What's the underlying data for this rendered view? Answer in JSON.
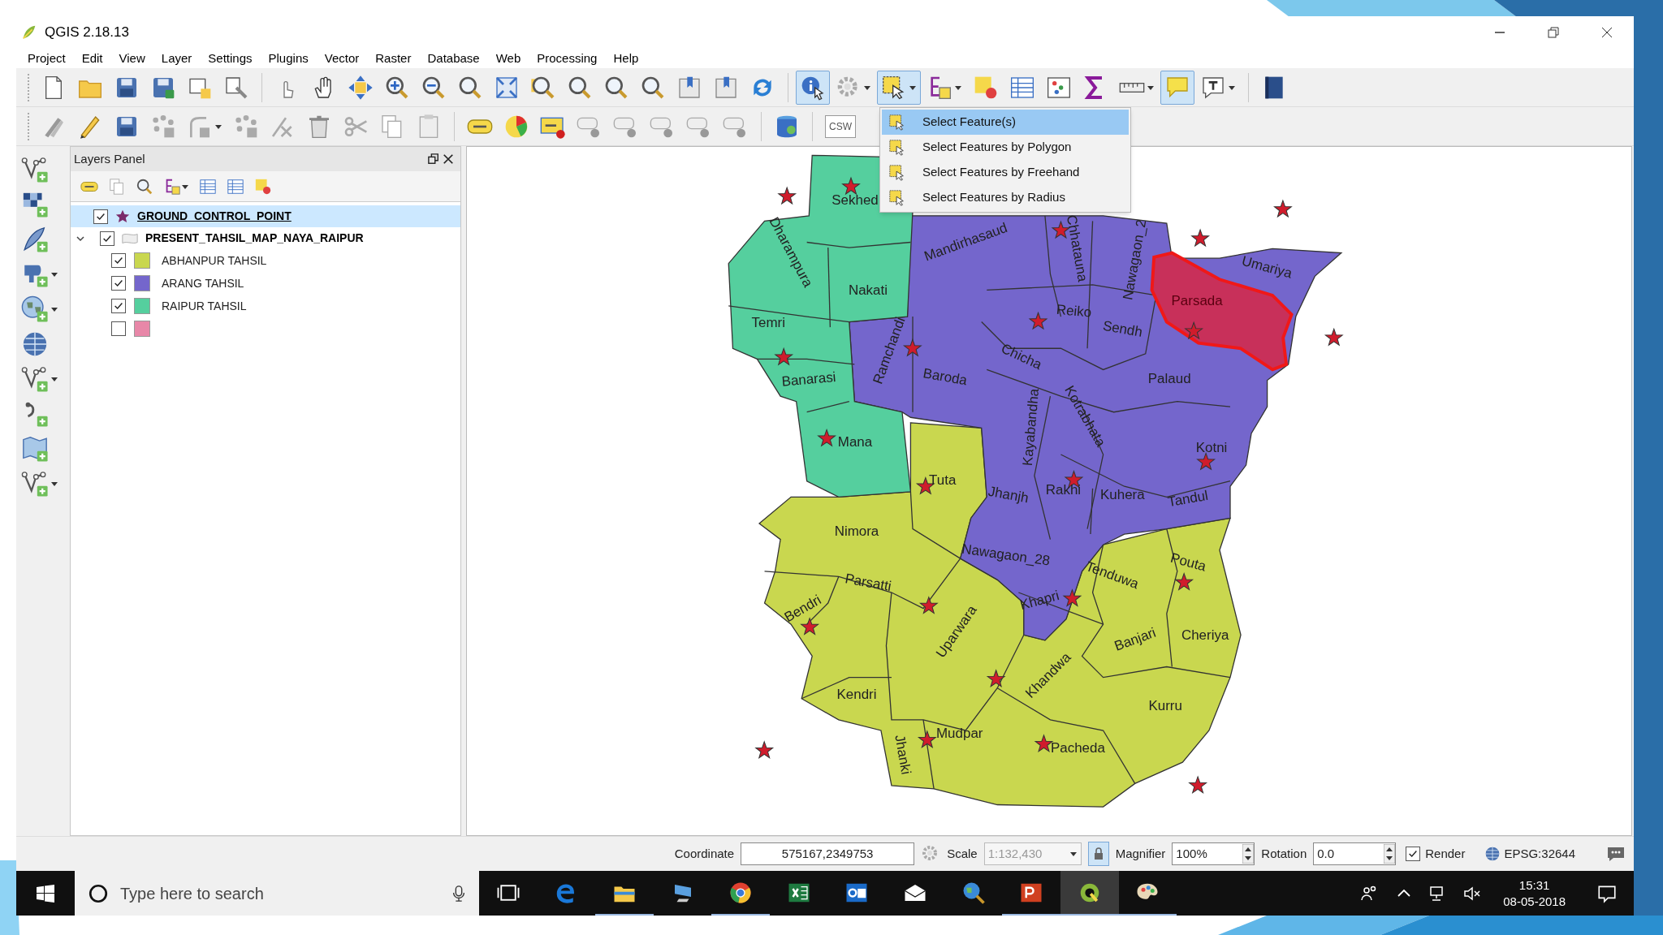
{
  "window": {
    "title": "QGIS 2.18.13"
  },
  "menu": [
    "Project",
    "Edit",
    "View",
    "Layer",
    "Settings",
    "Plugins",
    "Vector",
    "Raster",
    "Database",
    "Web",
    "Processing",
    "Help"
  ],
  "toolbar_1": [
    {
      "kind": "new",
      "pressed": false
    },
    {
      "kind": "open",
      "pressed": false
    },
    {
      "kind": "save",
      "pressed": false
    },
    {
      "kind": "save-as",
      "pressed": false
    },
    {
      "kind": "composer",
      "pressed": false
    },
    {
      "kind": "composer-manager",
      "pressed": false
    },
    {
      "kind": "separator"
    },
    {
      "kind": "touch",
      "pressed": false
    },
    {
      "kind": "pan",
      "pressed": false
    },
    {
      "kind": "pan-selection",
      "pressed": false
    },
    {
      "kind": "zoom-in",
      "pressed": false
    },
    {
      "kind": "zoom-out",
      "pressed": false
    },
    {
      "kind": "zoom-actual",
      "pressed": false
    },
    {
      "kind": "zoom-full",
      "pressed": false
    },
    {
      "kind": "zoom-selection",
      "pressed": false
    },
    {
      "kind": "zoom-layer",
      "pressed": false
    },
    {
      "kind": "zoom-last",
      "pressed": false
    },
    {
      "kind": "zoom-next",
      "pressed": false
    },
    {
      "kind": "bookmark",
      "pressed": false
    },
    {
      "kind": "bookmarks",
      "pressed": false
    },
    {
      "kind": "refresh",
      "pressed": false
    },
    {
      "kind": "separator"
    },
    {
      "kind": "identify",
      "pressed": true
    },
    {
      "kind": "action",
      "pressed": false,
      "menu": true
    },
    {
      "kind": "select",
      "pressed": true,
      "menu": true
    },
    {
      "kind": "select-expression",
      "pressed": false,
      "menu": true
    },
    {
      "kind": "deselect",
      "pressed": false
    },
    {
      "kind": "attribute-table",
      "pressed": false
    },
    {
      "kind": "field-calculator",
      "pressed": false
    },
    {
      "kind": "statistics",
      "pressed": false
    },
    {
      "kind": "measure",
      "pressed": false,
      "menu": true
    },
    {
      "kind": "map-tips",
      "pressed": true
    },
    {
      "kind": "annotation",
      "pressed": false,
      "menu": true
    },
    {
      "kind": "separator"
    },
    {
      "kind": "help",
      "pressed": false
    }
  ],
  "toolbar_2": [
    {
      "kind": "digitize",
      "pressed": false
    },
    {
      "kind": "edit",
      "pressed": false
    },
    {
      "kind": "save-edits",
      "pressed": false
    },
    {
      "kind": "add-feature",
      "pressed": false
    },
    {
      "kind": "add-part",
      "pressed": false,
      "menu": true
    },
    {
      "kind": "move-feature",
      "pressed": false
    },
    {
      "kind": "node-tool",
      "pressed": false
    },
    {
      "kind": "delete",
      "pressed": false
    },
    {
      "kind": "cut",
      "pressed": false
    },
    {
      "kind": "copy",
      "pressed": false
    },
    {
      "kind": "paste",
      "pressed": false
    },
    {
      "kind": "separator"
    },
    {
      "kind": "label",
      "pressed": false
    },
    {
      "kind": "diagram",
      "pressed": false
    },
    {
      "kind": "highlight-label",
      "pressed": false
    },
    {
      "kind": "pin-label",
      "pressed": false
    },
    {
      "kind": "show-label",
      "pressed": false
    },
    {
      "kind": "move-label",
      "pressed": false
    },
    {
      "kind": "rotate-label",
      "pressed": false
    },
    {
      "kind": "change-label",
      "pressed": false
    },
    {
      "kind": "separator"
    },
    {
      "kind": "database",
      "pressed": false
    },
    {
      "kind": "separator"
    },
    {
      "kind": "text",
      "label": "CSW",
      "pressed": false
    }
  ],
  "select_menu": [
    {
      "label": "Select Feature(s)",
      "selected": true
    },
    {
      "label": "Select Features by Polygon",
      "selected": false
    },
    {
      "label": "Select Features by Freehand",
      "selected": false
    },
    {
      "label": "Select Features by Radius",
      "selected": false
    }
  ],
  "layers_panel": {
    "title": "Layers Panel",
    "layers": [
      {
        "name": "GROUND_CONTROL_POINT",
        "kind": "point",
        "checked": true,
        "selected": true
      },
      {
        "name": "PRESENT_TAHSIL_MAP_NAYA_RAIPUR",
        "kind": "polygon",
        "checked": true,
        "selected": false,
        "expanded": true,
        "children": [
          {
            "label": "ABHANPUR TAHSIL",
            "checked": true,
            "color": "#c9d74f"
          },
          {
            "label": "ARANG TAHSIL",
            "checked": true,
            "color": "#7466cc"
          },
          {
            "label": "RAIPUR TAHSIL",
            "checked": true,
            "color": "#55cf9e"
          },
          {
            "checked": false,
            "color": "#e887a8"
          }
        ]
      }
    ]
  },
  "map": {
    "labels": [
      {
        "text": "Sekhed",
        "selected": false
      },
      {
        "text": "Dharampura",
        "selected": false
      },
      {
        "text": "Nakati",
        "selected": false
      },
      {
        "text": "Temri",
        "selected": false
      },
      {
        "text": "Mandirhasaud",
        "selected": false
      },
      {
        "text": "Chhatauna",
        "selected": false
      },
      {
        "text": "Nawagaon_2",
        "selected": false
      },
      {
        "text": "Umariya",
        "selected": false
      },
      {
        "text": "Parsada",
        "selected": true
      },
      {
        "text": "Reiko",
        "selected": false
      },
      {
        "text": "Sendh",
        "selected": false
      },
      {
        "text": "Ramchandi",
        "selected": false
      },
      {
        "text": "Chicha",
        "selected": false
      },
      {
        "text": "Baroda",
        "selected": false
      },
      {
        "text": "Banarasi",
        "selected": false
      },
      {
        "text": "Palaud",
        "selected": false
      },
      {
        "text": "Kayabandha",
        "selected": false
      },
      {
        "text": "Kotrabhata",
        "selected": false
      },
      {
        "text": "Mana",
        "selected": false
      },
      {
        "text": "Kotni",
        "selected": false
      },
      {
        "text": "Tuta",
        "selected": false
      },
      {
        "text": "Jhanjh",
        "selected": false
      },
      {
        "text": "Rakhi",
        "selected": false
      },
      {
        "text": "Kuhera",
        "selected": false
      },
      {
        "text": "Tandul",
        "selected": false
      },
      {
        "text": "Nimora",
        "selected": false
      },
      {
        "text": "Nawagaon_28",
        "selected": false
      },
      {
        "text": "Tenduwa",
        "selected": false
      },
      {
        "text": "Pouta",
        "selected": false
      },
      {
        "text": "Parsatti",
        "selected": false
      },
      {
        "text": "Khapri",
        "selected": false
      },
      {
        "text": "Bendri",
        "selected": false
      },
      {
        "text": "Uparwara",
        "selected": false
      },
      {
        "text": "Banjari",
        "selected": false
      },
      {
        "text": "Cheriya",
        "selected": false
      },
      {
        "text": "Khandwa",
        "selected": false
      },
      {
        "text": "Kendri",
        "selected": false
      },
      {
        "text": "Kurru",
        "selected": false
      },
      {
        "text": "Mudpar",
        "selected": false
      },
      {
        "text": "Jhanki",
        "selected": false
      },
      {
        "text": "Pacheda",
        "selected": false
      }
    ]
  },
  "status_bar": {
    "coordinate_label": "Coordinate",
    "coordinate": "575167,2349753",
    "scale_label": "Scale",
    "scale": "1:132,430",
    "magnifier_label": "Magnifier",
    "magnifier": "100%",
    "rotation_label": "Rotation",
    "rotation": "0.0",
    "render": {
      "label": "Render",
      "checked": true
    },
    "crs": "EPSG:32644"
  },
  "taskbar": {
    "search_placeholder": "Type here to search",
    "time": "15:31",
    "date": "08-05-2018",
    "apps": [
      {
        "kind": "task-view",
        "running": false,
        "selected": false
      },
      {
        "kind": "edge",
        "running": false,
        "selected": false
      },
      {
        "kind": "explorer",
        "running": true,
        "selected": false
      },
      {
        "kind": "monitor",
        "running": false,
        "selected": false
      },
      {
        "kind": "chrome",
        "running": true,
        "selected": false
      },
      {
        "kind": "excel",
        "running": false,
        "selected": false
      },
      {
        "kind": "outlook",
        "running": false,
        "selected": false
      },
      {
        "kind": "mail",
        "running": false,
        "selected": false
      },
      {
        "kind": "globe-search",
        "running": false,
        "selected": false
      },
      {
        "kind": "powerpoint",
        "running": true,
        "selected": false
      },
      {
        "kind": "qgis",
        "running": true,
        "selected": true
      },
      {
        "kind": "paint",
        "running": true,
        "selected": false
      }
    ]
  }
}
